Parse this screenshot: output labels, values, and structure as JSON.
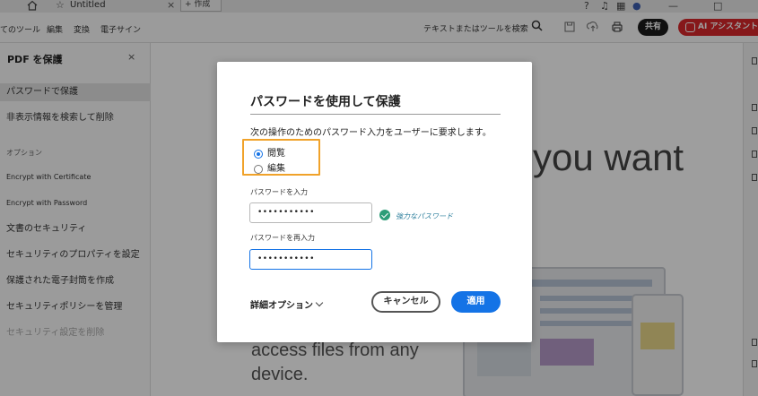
{
  "tabbar": {
    "tab_title": "Untitled",
    "new_tab_label": "+ 作成"
  },
  "toolbar": {
    "menus": [
      "てのツール",
      "編集",
      "変換",
      "電子サイン"
    ],
    "search_label": "テキストまたはツールを検索",
    "share_label": "共有",
    "ai_label": "AI アシスタント"
  },
  "left_panel": {
    "title": "PDF を保護",
    "items": [
      "パスワードで保護",
      "非表示情報を検索して削除"
    ],
    "section_label": "オプション",
    "options": [
      "Encrypt with Certificate",
      "Encrypt with Password",
      "文書のセキュリティ",
      "セキュリティのプロパティを設定",
      "保護された電子封筒を作成",
      "セキュリティポリシーを管理",
      "セキュリティ設定を削除"
    ]
  },
  "document": {
    "heading_fragment": "you want",
    "body_line1": "access files from any",
    "body_line2": "device."
  },
  "dialog": {
    "title": "パスワードを使用して保護",
    "description": "次の操作のためのパスワード入力をユーザーに要求します。",
    "radio_options": [
      {
        "label": "閲覧",
        "checked": true
      },
      {
        "label": "編集",
        "checked": false
      }
    ],
    "password_label": "パスワードを入力",
    "password_value": "•••••••••••",
    "strength_label": "強力なパスワード",
    "confirm_label": "パスワードを再入力",
    "confirm_value": "•••••••••••",
    "more_options_label": "詳細オプション",
    "cancel_label": "キャンセル",
    "apply_label": "適用"
  },
  "colors": {
    "accent": "#1473e6",
    "highlight_border": "#f0a22a",
    "success": "#2d9d78",
    "ai_button": "#d8282a"
  }
}
